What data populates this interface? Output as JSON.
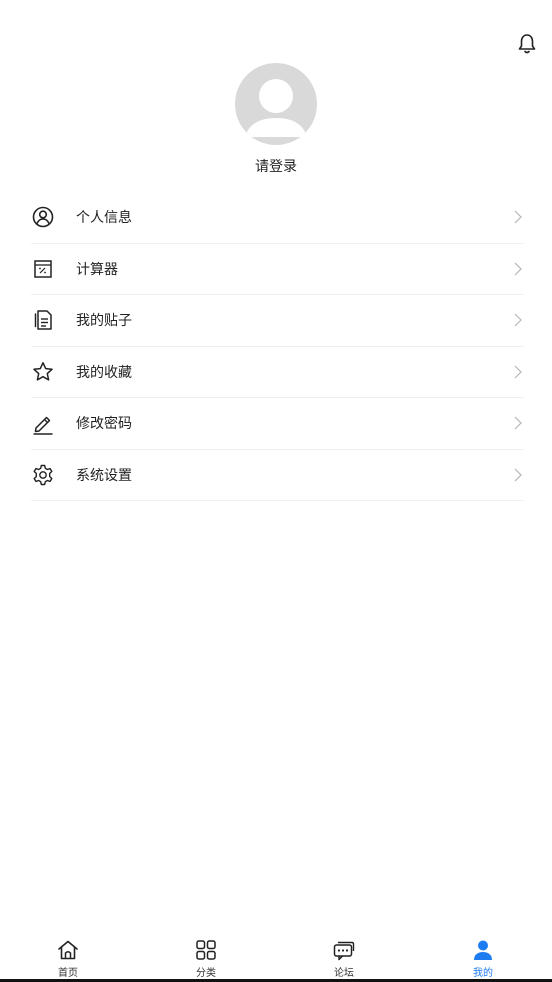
{
  "header": {
    "bell_icon": "bell-icon"
  },
  "profile": {
    "avatar_icon": "default-avatar",
    "login_text": "请登录"
  },
  "menu": [
    {
      "label": "个人信息",
      "icon": "user-circle-icon"
    },
    {
      "label": "计算器",
      "icon": "calculator-icon"
    },
    {
      "label": "我的贴子",
      "icon": "document-icon"
    },
    {
      "label": "我的收藏",
      "icon": "star-icon"
    },
    {
      "label": "修改密码",
      "icon": "pencil-icon"
    },
    {
      "label": "系统设置",
      "icon": "gear-icon"
    }
  ],
  "tabbar": {
    "active_color": "#1e7cf2",
    "tabs": [
      {
        "label": "首页",
        "icon": "home-icon",
        "active": false
      },
      {
        "label": "分类",
        "icon": "grid-icon",
        "active": false
      },
      {
        "label": "论坛",
        "icon": "chat-icon",
        "active": false
      },
      {
        "label": "我的",
        "icon": "person-icon",
        "active": true
      }
    ]
  }
}
